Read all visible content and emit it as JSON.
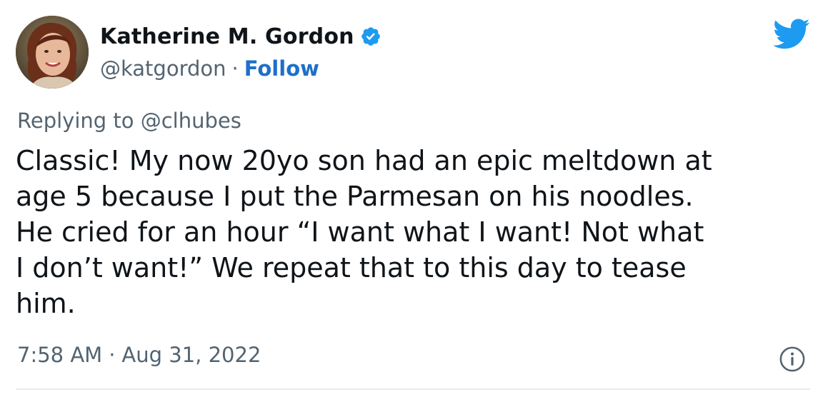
{
  "author": {
    "display_name": "Katherine M. Gordon",
    "handle": "@katgordon",
    "separator": "·",
    "follow_label": "Follow",
    "verified_icon": "verified-badge-icon"
  },
  "reply": {
    "prefix": "Replying to",
    "mention": "@clhubes"
  },
  "tweet": {
    "lines": [
      "Classic! My now 20yo son had an epic meltdown at",
      "age 5 because I put the Parmesan on his noodles.",
      "He cried for an hour “I want what I want! Not what",
      "I don’t want!” We repeat that to this day to tease",
      "him."
    ]
  },
  "meta": {
    "time": "7:58 AM",
    "separator": "·",
    "date": "Aug 31, 2022",
    "info_icon": "info-icon"
  },
  "colors": {
    "text": "#0f1419",
    "secondary": "#536471",
    "link": "#1d70c9",
    "twitter_blue": "#1d9bf0"
  },
  "icons": {
    "brand": "twitter-bird-icon"
  }
}
